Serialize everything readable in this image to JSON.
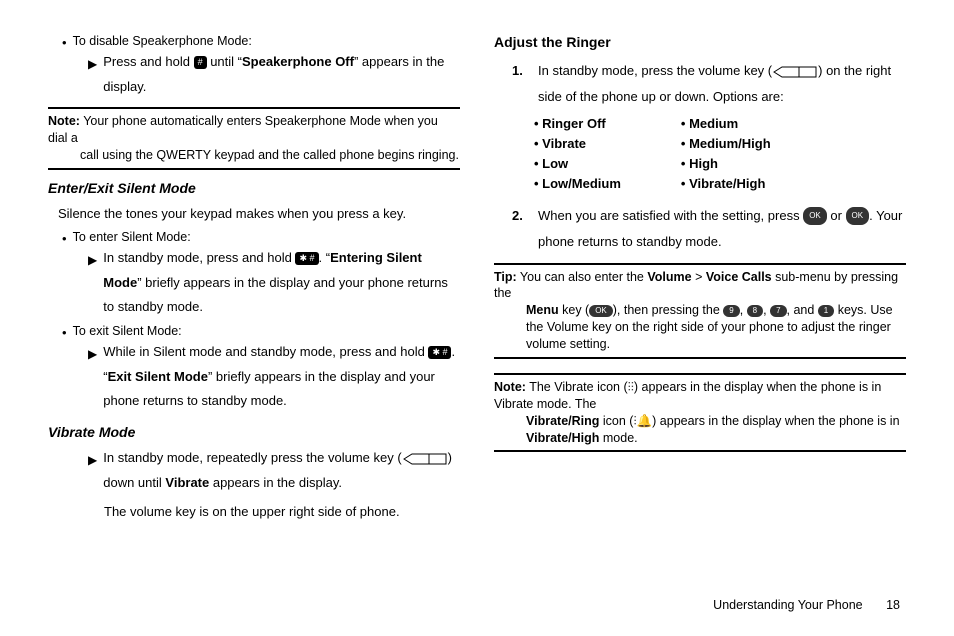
{
  "left": {
    "disable_sp": "To disable Speakerphone Mode:",
    "disable_sp_step_a": "Press and hold ",
    "disable_sp_step_b": " until “",
    "disable_sp_bold": "Speakerphone Off",
    "disable_sp_step_c": "” appears in the display.",
    "note1_label": "Note:",
    "note1_a": " Your phone automatically enters Speakerphone Mode when you dial a",
    "note1_b": "call using the QWERTY keypad and the called phone begins ringing.",
    "h_silent": "Enter/Exit Silent Mode",
    "silent_intro": "Silence the tones your keypad makes when you press a key.",
    "enter_silent": "To enter Silent Mode:",
    "enter_step_a": "In standby mode, press and hold ",
    "enter_step_b": ". “",
    "enter_bold": "Entering Silent Mode",
    "enter_step_c": "” briefly appears in the display and your phone returns to standby mode.",
    "exit_silent": "To exit Silent Mode:",
    "exit_step_a": "While in Silent mode and standby mode, press and hold ",
    "exit_step_b": ". “",
    "exit_bold": "Exit Silent Mode",
    "exit_step_c": "” briefly appears in the display and your phone returns to standby mode.",
    "h_vibrate": "Vibrate Mode",
    "vib_a": "In standby mode, repeatedly press the volume key (",
    "vib_b": ") down until ",
    "vib_bold": "Vibrate",
    "vib_c": " appears in the display.",
    "vib_note": "The volume key is on the upper right side of phone."
  },
  "right": {
    "h_adjust": "Adjust the Ringer",
    "s1_num": "1.",
    "s1_a": "In standby mode, press the volume key (",
    "s1_b": ") on the right side of the phone up or down. Options are:",
    "opts_left": [
      "Ringer Off",
      "Vibrate",
      "Low",
      "Low/Medium"
    ],
    "opts_right": [
      "Medium",
      "Medium/High",
      "High",
      "Vibrate/High"
    ],
    "s2_num": "2.",
    "s2_a": "When you are satisfied with the setting, press ",
    "s2_or": " or ",
    "s2_b": ". Your phone returns to standby mode.",
    "tip_label": "Tip:",
    "tip_a": " You can also enter the ",
    "tip_vol": "Volume",
    "tip_gt": " > ",
    "tip_vc": "Voice Calls",
    "tip_b": " sub-menu by pressing the ",
    "tip_menu": "Menu",
    "tip_c": " key (",
    "tip_d": "), then pressing the ",
    "tip_e": ", ",
    "tip_f": ", ",
    "tip_g": ", and ",
    "tip_h": " keys. Use the Volume key on the right side of your phone to adjust the ringer volume setting.",
    "note2_label": "Note:",
    "note2_a": " The Vibrate icon (",
    "note2_b": ") appears in the display when the phone is in Vibrate mode. The ",
    "note2_vr": "Vibrate/Ring",
    "note2_c": " icon (",
    "note2_d": ") appears in the display when the phone is in ",
    "note2_vh": "Vibrate/High",
    "note2_e": " mode."
  },
  "footer": {
    "section": "Understanding Your Phone",
    "page": "18"
  },
  "icons": {
    "pound": "#",
    "ok": "OK",
    "starpound": "✱ #"
  }
}
